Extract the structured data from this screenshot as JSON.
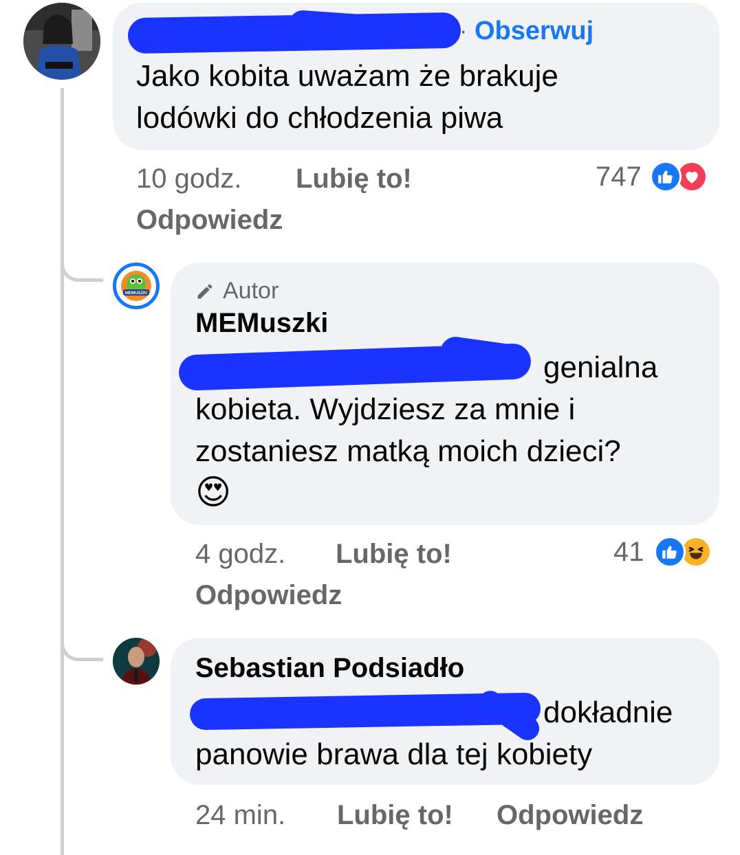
{
  "comment1": {
    "author_redacted": "redacted name",
    "follow_label": "Obserwuj",
    "follow_separator": "·",
    "text_line1": "Jako kobita uważam że brakuje",
    "text_line2": "lodówki do chłodzenia piwa",
    "time": "10 godz.",
    "like_label": "Lubię to!",
    "reply_label": "Odpowiedz",
    "reaction_count": "747",
    "reactions": [
      "like-icon",
      "love-icon"
    ]
  },
  "comment2": {
    "badge_label": "Autor",
    "badge_icon": "pencil-icon",
    "author": "MEMuszki",
    "avatar_text": "MEMUSZKI",
    "text_line1_tail": "genialna",
    "text_line2": "kobieta. Wyjdziesz za mnie i",
    "text_line3": "zostaniesz matką moich dzieci?",
    "emoji": "😍",
    "time": "4 godz.",
    "like_label": "Lubię to!",
    "reply_label": "Odpowiedz",
    "reaction_count": "41",
    "reactions": [
      "like-icon",
      "haha-icon"
    ]
  },
  "comment3": {
    "author": "Sebastian Podsiadło",
    "text_line1_tail": "dokładnie",
    "text_line2": "panowie brawa dla tej kobiety",
    "time": "24 min.",
    "like_label": "Lubię to!",
    "reply_label": "Odpowiedz"
  },
  "colors": {
    "link_blue": "#1877f2",
    "bubble_gray": "#f0f2f5",
    "meta_gray": "#65676b",
    "redaction_blue": "#1a33ff"
  }
}
